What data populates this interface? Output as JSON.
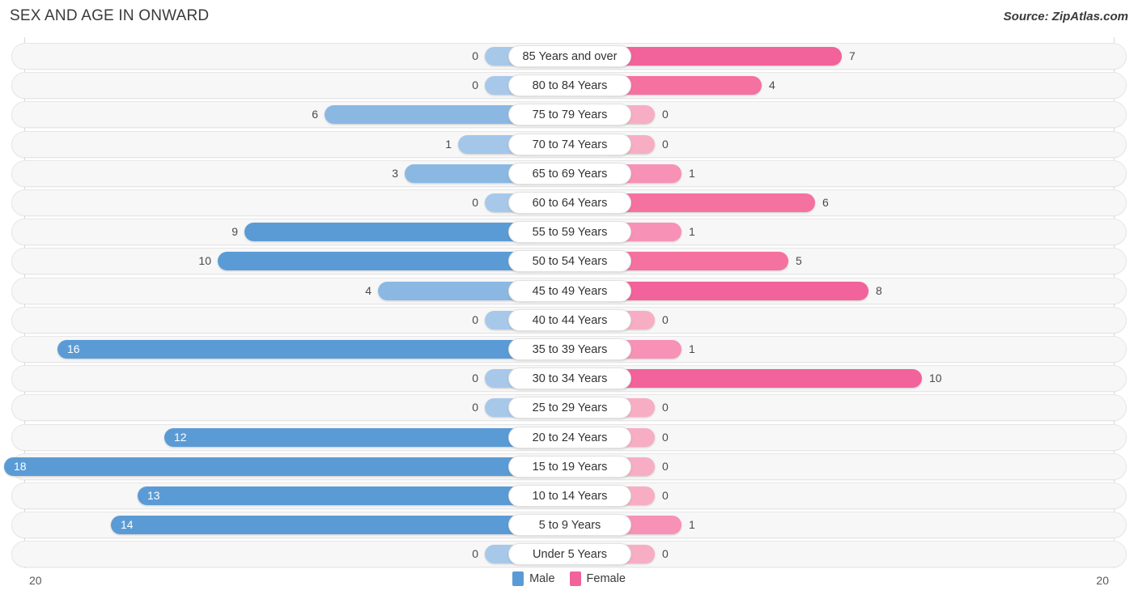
{
  "header": {
    "title": "SEX AND AGE IN ONWARD",
    "source": "Source: ZipAtlas.com"
  },
  "legend": {
    "male_label": "Male",
    "female_label": "Female",
    "male_color": "#5b9bd5",
    "female_color": "#f2629b"
  },
  "axis": {
    "left_tick": "20",
    "right_tick": "20",
    "max": 20
  },
  "colors": {
    "male_strong": "#5b9bd5",
    "male_light": "#a8c8ea",
    "female_strong": "#f2629b",
    "female_mid": "#f77fab",
    "female_light": "#f7aec4",
    "row_background": "#f7f7f7",
    "row_border": "#e6e6e6",
    "axis_line": "#d9dadb"
  },
  "chart_data": {
    "type": "bar",
    "title": "SEX AND AGE IN ONWARD",
    "subtitle": "Source: ZipAtlas.com",
    "xlabel": "",
    "ylabel": "",
    "orientation": "horizontal",
    "style": "population-pyramid",
    "xlim": [
      -20,
      20
    ],
    "grid": false,
    "legend_position": "bottom-center",
    "categories": [
      "85 Years and over",
      "80 to 84 Years",
      "75 to 79 Years",
      "70 to 74 Years",
      "65 to 69 Years",
      "60 to 64 Years",
      "55 to 59 Years",
      "50 to 54 Years",
      "45 to 49 Years",
      "40 to 44 Years",
      "35 to 39 Years",
      "30 to 34 Years",
      "25 to 29 Years",
      "20 to 24 Years",
      "15 to 19 Years",
      "10 to 14 Years",
      "5 to 9 Years",
      "Under 5 Years"
    ],
    "series": [
      {
        "name": "Male",
        "color": "#5b9bd5",
        "values": [
          0,
          0,
          6,
          1,
          3,
          0,
          9,
          10,
          4,
          0,
          16,
          0,
          0,
          12,
          18,
          13,
          14,
          0
        ]
      },
      {
        "name": "Female",
        "color": "#f2629b",
        "values": [
          7,
          4,
          0,
          0,
          1,
          6,
          1,
          5,
          8,
          0,
          1,
          10,
          0,
          0,
          0,
          0,
          1,
          0
        ]
      }
    ]
  },
  "rows": [
    {
      "label": "85 Years and over",
      "male": "0",
      "female": "7",
      "male_v": 0,
      "female_v": 7
    },
    {
      "label": "80 to 84 Years",
      "male": "0",
      "female": "4",
      "male_v": 0,
      "female_v": 4
    },
    {
      "label": "75 to 79 Years",
      "male": "6",
      "female": "0",
      "male_v": 6,
      "female_v": 0
    },
    {
      "label": "70 to 74 Years",
      "male": "1",
      "female": "0",
      "male_v": 1,
      "female_v": 0
    },
    {
      "label": "65 to 69 Years",
      "male": "3",
      "female": "1",
      "male_v": 3,
      "female_v": 1
    },
    {
      "label": "60 to 64 Years",
      "male": "0",
      "female": "6",
      "male_v": 0,
      "female_v": 6
    },
    {
      "label": "55 to 59 Years",
      "male": "9",
      "female": "1",
      "male_v": 9,
      "female_v": 1
    },
    {
      "label": "50 to 54 Years",
      "male": "10",
      "female": "5",
      "male_v": 10,
      "female_v": 5
    },
    {
      "label": "45 to 49 Years",
      "male": "4",
      "female": "8",
      "male_v": 4,
      "female_v": 8
    },
    {
      "label": "40 to 44 Years",
      "male": "0",
      "female": "0",
      "male_v": 0,
      "female_v": 0
    },
    {
      "label": "35 to 39 Years",
      "male": "16",
      "female": "1",
      "male_v": 16,
      "female_v": 1
    },
    {
      "label": "30 to 34 Years",
      "male": "0",
      "female": "10",
      "male_v": 0,
      "female_v": 10
    },
    {
      "label": "25 to 29 Years",
      "male": "0",
      "female": "0",
      "male_v": 0,
      "female_v": 0
    },
    {
      "label": "20 to 24 Years",
      "male": "12",
      "female": "0",
      "male_v": 12,
      "female_v": 0
    },
    {
      "label": "15 to 19 Years",
      "male": "18",
      "female": "0",
      "male_v": 18,
      "female_v": 0
    },
    {
      "label": "10 to 14 Years",
      "male": "13",
      "female": "0",
      "male_v": 13,
      "female_v": 0
    },
    {
      "label": "5 to 9 Years",
      "male": "14",
      "female": "1",
      "male_v": 14,
      "female_v": 1
    },
    {
      "label": "Under 5 Years",
      "male": "0",
      "female": "0",
      "male_v": 0,
      "female_v": 0
    }
  ]
}
